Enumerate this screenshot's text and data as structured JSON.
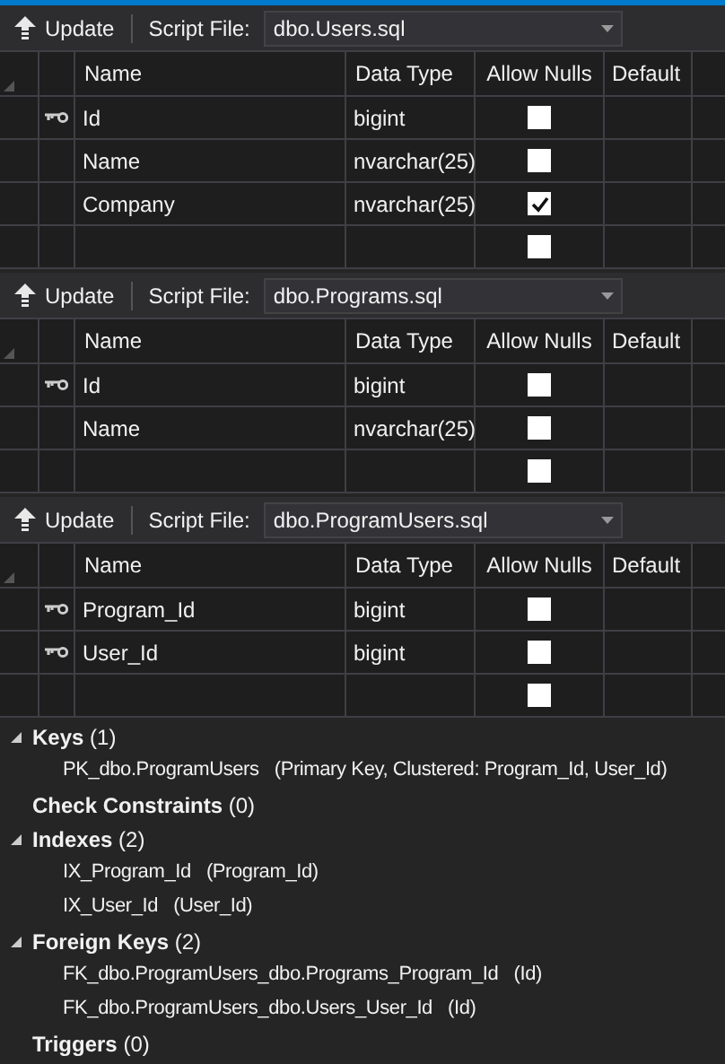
{
  "tables": [
    {
      "update": "Update",
      "script_label": "Script File:",
      "script_file": "dbo.Users.sql",
      "columns": [
        "Name",
        "Data Type",
        "Allow Nulls",
        "Default"
      ],
      "rows": [
        {
          "kind": "column",
          "key": true,
          "name": "Id",
          "data_type": "bigint",
          "allow_nulls": false
        },
        {
          "kind": "column",
          "key": false,
          "name": "Name",
          "data_type": "nvarchar(25)",
          "allow_nulls": false
        },
        {
          "kind": "column",
          "key": false,
          "name": "Company",
          "data_type": "nvarchar(25)",
          "allow_nulls": true
        },
        {
          "kind": "new",
          "allow_nulls": false
        }
      ]
    },
    {
      "update": "Update",
      "script_label": "Script File:",
      "script_file": "dbo.Programs.sql",
      "columns": [
        "Name",
        "Data Type",
        "Allow Nulls",
        "Default"
      ],
      "rows": [
        {
          "kind": "column",
          "key": true,
          "name": "Id",
          "data_type": "bigint",
          "allow_nulls": false
        },
        {
          "kind": "column",
          "key": false,
          "name": "Name",
          "data_type": "nvarchar(25)",
          "allow_nulls": false
        },
        {
          "kind": "new",
          "allow_nulls": false
        }
      ]
    },
    {
      "update": "Update",
      "script_label": "Script File:",
      "script_file": "dbo.ProgramUsers.sql",
      "columns": [
        "Name",
        "Data Type",
        "Allow Nulls",
        "Default"
      ],
      "rows": [
        {
          "kind": "column",
          "key": true,
          "name": "Program_Id",
          "data_type": "bigint",
          "allow_nulls": false
        },
        {
          "kind": "column",
          "key": true,
          "name": "User_Id",
          "data_type": "bigint",
          "allow_nulls": false
        },
        {
          "kind": "new",
          "allow_nulls": false
        }
      ]
    }
  ],
  "tree": [
    {
      "label": "Keys",
      "count": "(1)",
      "expanded": true,
      "children": [
        {
          "name": "PK_dbo.ProgramUsers",
          "detail": "(Primary Key, Clustered: Program_Id, User_Id)"
        }
      ]
    },
    {
      "label": "Check Constraints",
      "count": "(0)"
    },
    {
      "label": "Indexes",
      "count": "(2)",
      "expanded": true,
      "children": [
        {
          "name": "IX_Program_Id",
          "detail": "(Program_Id)"
        },
        {
          "name": "IX_User_Id",
          "detail": "(User_Id)"
        }
      ]
    },
    {
      "label": "Foreign Keys",
      "count": "(2)",
      "expanded": true,
      "children": [
        {
          "name": "FK_dbo.ProgramUsers_dbo.Programs_Program_Id",
          "detail": "(Id)"
        },
        {
          "name": "FK_dbo.ProgramUsers_dbo.Users_User_Id",
          "detail": "(Id)"
        }
      ]
    },
    {
      "label": "Triggers",
      "count": "(0)"
    }
  ]
}
